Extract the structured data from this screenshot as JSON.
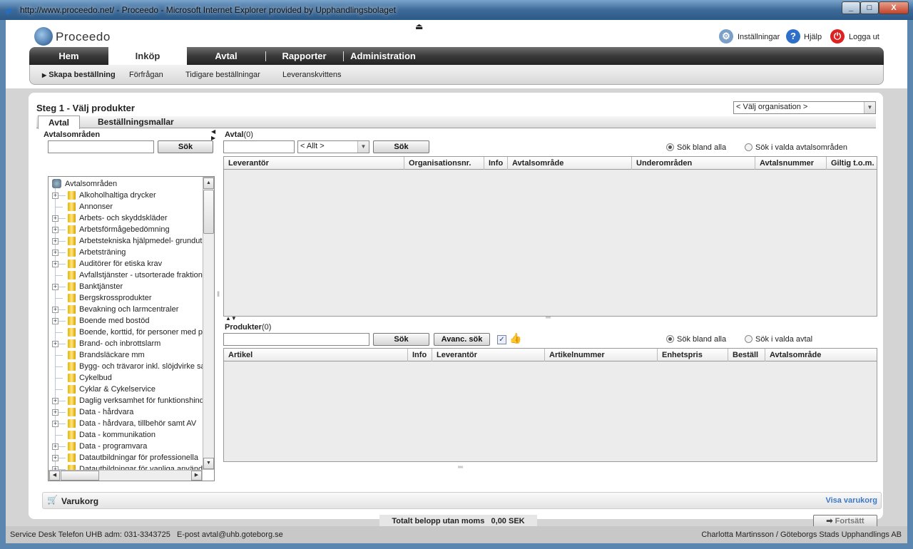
{
  "window": {
    "title": "http://www.proceedo.net/ - Proceedo - Microsoft Internet Explorer provided by Upphandlingsbolaget"
  },
  "header": {
    "logo": "Proceedo",
    "links": [
      {
        "label": "Inställningar",
        "icon": "settings-user-icon"
      },
      {
        "label": "Hjälp",
        "icon": "help-icon"
      },
      {
        "label": "Logga ut",
        "icon": "power-icon"
      }
    ]
  },
  "nav": {
    "tabs": [
      "Hem",
      "Inköp",
      "Avtal",
      "Rapporter",
      "Administration"
    ],
    "active": "Inköp",
    "sub": [
      "Skapa beställning",
      "Förfrågan",
      "Tidigare beställningar",
      "Leveranskvittens"
    ]
  },
  "page": {
    "title": "Steg 1 - Välj produkter",
    "org_select": "< Välj organisation >",
    "tabs": [
      "Avtal",
      "Beställningsmallar"
    ]
  },
  "left": {
    "label": "Avtalsområden",
    "search_button": "Sök",
    "tree_root": "Avtalsområden",
    "tree": [
      {
        "label": "Alkoholhaltiga drycker",
        "expandable": true
      },
      {
        "label": "Annonser",
        "expandable": false
      },
      {
        "label": "Arbets- och skyddskläder",
        "expandable": true
      },
      {
        "label": "Arbetsförmågebedömning",
        "expandable": true
      },
      {
        "label": "Arbetstekniska hjälpmedel- grundutr",
        "expandable": true
      },
      {
        "label": "Arbetsträning",
        "expandable": true
      },
      {
        "label": "Auditörer för etiska krav",
        "expandable": true
      },
      {
        "label": "Avfallstjänster - utsorterade fraktion",
        "expandable": false
      },
      {
        "label": "Banktjänster",
        "expandable": true
      },
      {
        "label": "Bergskrossprodukter",
        "expandable": false
      },
      {
        "label": "Bevakning och larmcentraler",
        "expandable": true
      },
      {
        "label": "Boende med bostöd",
        "expandable": true
      },
      {
        "label": "Boende, korttid, för personer med p",
        "expandable": false
      },
      {
        "label": "Brand- och inbrottslarm",
        "expandable": true
      },
      {
        "label": "Brandsläckare mm",
        "expandable": false
      },
      {
        "label": "Bygg- och trävaror inkl. slöjdvirke sa",
        "expandable": false
      },
      {
        "label": "Cykelbud",
        "expandable": false
      },
      {
        "label": "Cyklar & Cykelservice",
        "expandable": false
      },
      {
        "label": "Daglig verksamhet för funktionshind",
        "expandable": true
      },
      {
        "label": "Data - hårdvara",
        "expandable": true
      },
      {
        "label": "Data - hårdvara, tillbehör samt AV",
        "expandable": true
      },
      {
        "label": "Data - kommunikation",
        "expandable": false
      },
      {
        "label": "Data - programvara",
        "expandable": true
      },
      {
        "label": "Datautbildningar för professionella",
        "expandable": true
      },
      {
        "label": "Datautbildningar för vanliga använd",
        "expandable": true
      }
    ]
  },
  "avtal": {
    "label": "Avtal",
    "count": "(0)",
    "filter": "< Allt >",
    "search_button": "Sök",
    "radio_all": "Sök bland alla",
    "radio_selected": "Sök i valda avtalsområden",
    "radio_value": "all",
    "columns": [
      "Leverantör",
      "Organisationsnr.",
      "Info",
      "Avtalsområde",
      "Underområden",
      "Avtalsnummer",
      "Giltig t.o.m."
    ]
  },
  "produkter": {
    "label": "Produkter",
    "count": "(0)",
    "search_button": "Sök",
    "advanced_button": "Avanc. sök",
    "checkbox_checked": true,
    "radio_all": "Sök bland alla",
    "radio_selected": "Sök i valda avtal",
    "radio_value": "all",
    "columns": [
      "Artikel",
      "Info",
      "Leverantör",
      "Artikelnummer",
      "Enhetspris",
      "Beställ",
      "Avtalsområde"
    ]
  },
  "cart": {
    "label": "Varukorg",
    "link": "Visa varukorg",
    "total_label": "Totalt belopp utan moms",
    "total_value": "0,00 SEK",
    "continue": "Fortsätt"
  },
  "footer": {
    "left": "Service Desk Telefon UHB adm: 031-3343725   E-post avtal@uhb.goteborg.se",
    "right": "Charlotta Martinsson / Göteborgs Stads Upphandlings AB"
  }
}
